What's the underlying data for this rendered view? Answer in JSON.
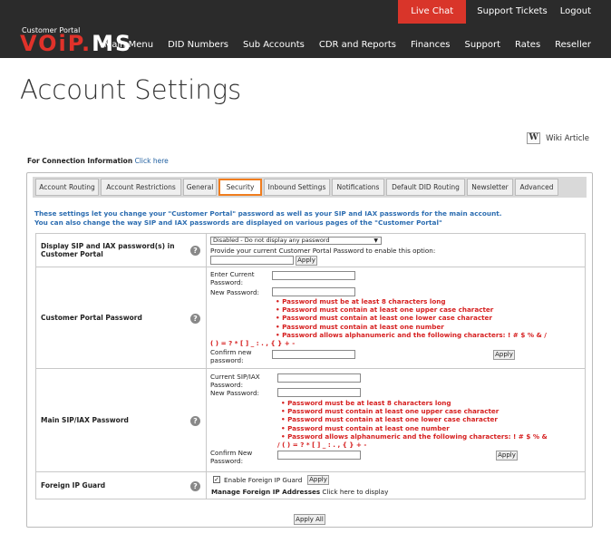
{
  "util": {
    "live_chat": "Live Chat",
    "support_tickets": "Support Tickets",
    "logout": "Logout"
  },
  "brand": {
    "subtitle": "Customer Portal",
    "logo_part1": "VOiP.",
    "logo_part2": "MS"
  },
  "nav": [
    "Main Menu",
    "DID Numbers",
    "Sub Accounts",
    "CDR and Reports",
    "Finances",
    "Support",
    "Rates",
    "Reseller"
  ],
  "page_title": "Account Settings",
  "wiki": {
    "icon": "W",
    "label": "Wiki Article"
  },
  "connection": {
    "label": "For Connection Information",
    "link": "Click here"
  },
  "tabs": [
    "Account Routing",
    "Account Restrictions",
    "General",
    "Security",
    "Inbound Settings",
    "Notifications",
    "Default DID Routing",
    "Newsletter",
    "Advanced"
  ],
  "active_tab": "Security",
  "intro": {
    "line1": "These settings let you change your \"Customer Portal\" password as well as your SIP and IAX passwords for the main account.",
    "line2": "You can also change the way SIP and IAX passwords are displayed on various pages of the \"Customer Portal\""
  },
  "display_sip": {
    "label": "Display SIP and IAX password(s) in Customer Portal",
    "select_value": "Disabled - Do not display any password",
    "hint": "Provide your current Customer Portal Password to enable this option:",
    "apply": "Apply"
  },
  "portal_pw": {
    "label": "Customer Portal Password",
    "current": "Enter Current Password:",
    "new": "New Password:",
    "rules": [
      "• Password must be at least 8 characters long",
      "• Password must contain at least one upper case character",
      "• Password must contain at least one lower case character",
      "• Password must contain at least one number",
      "• Password allows alphanumeric and the following characters: ! # $ % & /",
      "( ) = ? * [ ] _ : . , { } + -"
    ],
    "confirm": "Confirm new password:",
    "apply": "Apply"
  },
  "sip_pw": {
    "label": "Main SIP/IAX Password",
    "current": "Current SIP/IAX Password:",
    "new": "New Password:",
    "rules": [
      "• Password must be at least 8 characters long",
      "• Password must contain at least one upper case character",
      "• Password must contain at least one lower case character",
      "• Password must contain at least one number",
      "• Password allows alphanumeric and the following characters: ! # $ % &",
      "/ ( ) = ? * [ ] _ : . , { } + -"
    ],
    "confirm": "Confirm New Password:",
    "apply": "Apply"
  },
  "foreign_ip": {
    "label": "Foreign IP Guard",
    "checkbox_label": "Enable Foreign IP Guard",
    "checked": true,
    "apply": "Apply",
    "manage_label": "Manage Foreign IP Addresses",
    "manage_link": "Click here to display"
  },
  "help_icon": "?",
  "apply_all": "Apply All",
  "colors": {
    "topbar": "#2b2b2b",
    "live_chat": "#d9352a",
    "active_tab_border": "#f07d1e",
    "intro_text": "#2b6cb0",
    "rules_text": "#d62020"
  }
}
